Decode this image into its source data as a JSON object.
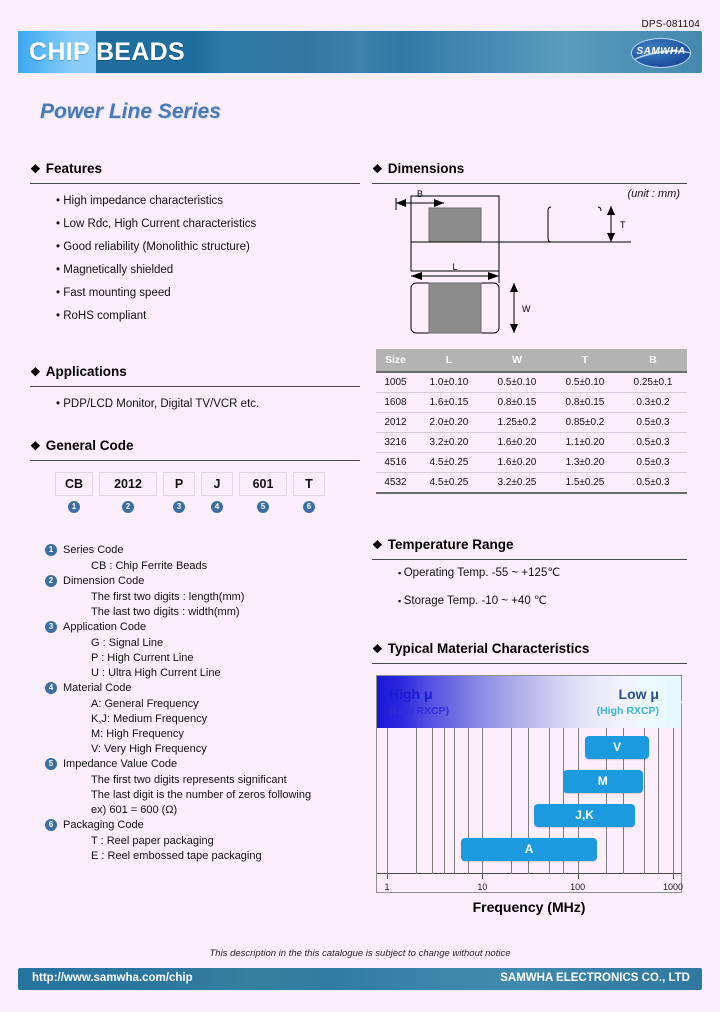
{
  "doc_code": "DPS-081104",
  "header": {
    "title_part1": "CHIP",
    "title_part2": "BEADS",
    "logo_text": "SAMWHA"
  },
  "series_title": "Power Line Series",
  "sections": {
    "features": "Features",
    "applications": "Applications",
    "general_code": "General Code",
    "dimensions": "Dimensions",
    "temperature_range": "Temperature Range",
    "typical_material": "Typical Material Characteristics"
  },
  "features": [
    "High impedance characteristics",
    "Low Rdc, High Current characteristics",
    "Good reliability (Monolithic structure)",
    "Magnetically shielded",
    "Fast mounting speed",
    "RoHS compliant"
  ],
  "applications": [
    "PDP/LCD Monitor, Digital TV/VCR etc."
  ],
  "general_code": {
    "boxes": [
      {
        "value": "CB",
        "num": "1"
      },
      {
        "value": "2012",
        "num": "2"
      },
      {
        "value": "P",
        "num": "3"
      },
      {
        "value": "J",
        "num": "4"
      },
      {
        "value": "601",
        "num": "5"
      },
      {
        "value": "T",
        "num": "6"
      }
    ],
    "legend": [
      {
        "num": "1",
        "title": "Series Code",
        "lines": [
          "CB : Chip Ferrite Beads"
        ]
      },
      {
        "num": "2",
        "title": "Dimension Code",
        "lines": [
          "The first two digits : length(mm)",
          "The last two digits : width(mm)"
        ]
      },
      {
        "num": "3",
        "title": "Application Code",
        "lines": [
          "G : Signal Line",
          "P : High Current Line",
          "U : Ultra High Current Line"
        ]
      },
      {
        "num": "4",
        "title": "Material Code",
        "lines": [
          "A: General Frequency",
          "K,J: Medium Frequency",
          "M: High Frequency",
          "V: Very High Frequency"
        ]
      },
      {
        "num": "5",
        "title": "Impedance Value Code",
        "lines": [
          "The first two digits represents significant",
          "The last digit is the number of zeros following",
          " ex) 601 = 600 (Ω)"
        ]
      },
      {
        "num": "6",
        "title": "Packaging Code",
        "lines": [
          "T : Reel paper packaging",
          "E : Reel embossed tape packaging"
        ]
      }
    ]
  },
  "dimensions": {
    "unit_note": "(unit : mm)",
    "drawing_labels": {
      "b": "B",
      "l": "L",
      "w": "W",
      "t": "T"
    },
    "table": {
      "columns": [
        "Size",
        "L",
        "W",
        "T",
        "B"
      ],
      "rows": [
        [
          "1005",
          "1.0±0.10",
          "0.5±0.10",
          "0.5±0.10",
          "0.25±0.1"
        ],
        [
          "1608",
          "1.6±0.15",
          "0.8±0.15",
          "0.8±0.15",
          "0.3±0.2"
        ],
        [
          "2012",
          "2.0±0.20",
          "1.25±0.2",
          "0.85±0.2",
          "0.5±0.3"
        ],
        [
          "3216",
          "3.2±0.20",
          "1.6±0.20",
          "1.1±0.20",
          "0.5±0.3"
        ],
        [
          "4516",
          "4.5±0.25",
          "1.6±0.20",
          "1.3±0.20",
          "0.5±0.3"
        ],
        [
          "4532",
          "4.5±0.25",
          "3.2±0.25",
          "1.5±0.25",
          "0.5±0.3"
        ]
      ]
    }
  },
  "temperature_range": [
    "Operating Temp.  -55 ~ +125℃",
    "Storage Temp.  -10 ~ +40 ℃"
  ],
  "chart_data": {
    "type": "bar",
    "title": "Typical Material Characteristics",
    "xlabel": "Frequency (MHz)",
    "ylabel": "",
    "xscale": "log",
    "xlim": [
      1,
      1000
    ],
    "tick_labels": [
      "1",
      "10",
      "100",
      "1000"
    ],
    "tick_values": [
      1,
      10,
      100,
      1000
    ],
    "grid": true,
    "legend_position": "none",
    "band": {
      "left_label": "High μ",
      "left_sublabel": "(Low RXCP)",
      "right_label": "Low μ",
      "right_sublabel": "(High RXCP)"
    },
    "series": [
      {
        "name": "V",
        "start": 120,
        "end": 560
      },
      {
        "name": "M",
        "start": 70,
        "end": 480
      },
      {
        "name": "J,K",
        "start": 35,
        "end": 400
      },
      {
        "name": "A",
        "start": 6,
        "end": 160
      }
    ]
  },
  "footer": {
    "notice": "This description in the this catalogue is subject to change without notice",
    "url": "http://www.samwha.com/chip",
    "company": "SAMWHA ELECTRONICS CO., LTD"
  }
}
